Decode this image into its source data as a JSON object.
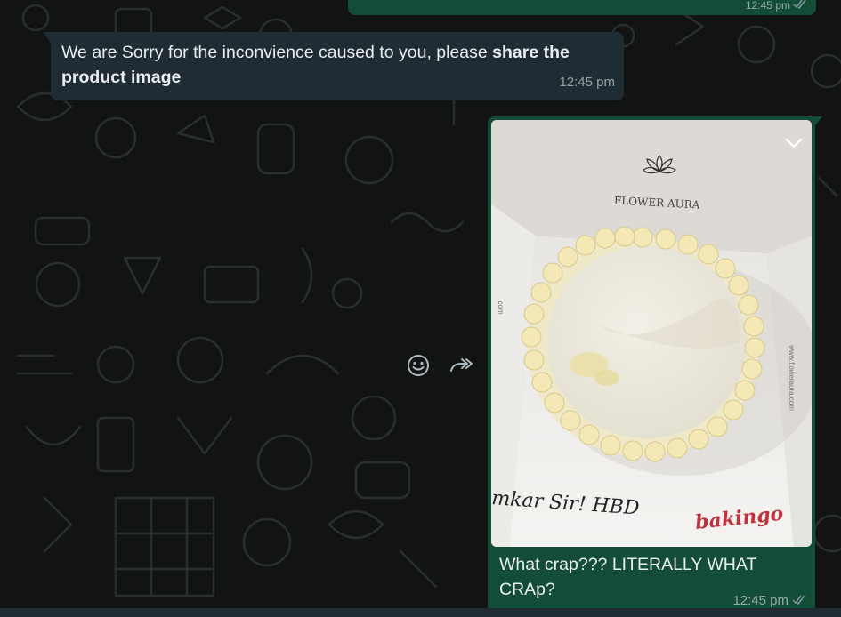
{
  "colors": {
    "background": "#121413",
    "incoming_bubble": "#202c33",
    "outgoing_bubble": "#144d37",
    "text": "#e9edef",
    "meta_text": "#8696a0"
  },
  "messages": [
    {
      "direction": "outgoing",
      "time": "12:45 pm",
      "status_icon": "double-check-icon"
    },
    {
      "direction": "incoming",
      "text_regular": "We are Sorry for the inconvience caused to you, please ",
      "text_bold": "share the product image",
      "time": "12:45 pm"
    },
    {
      "direction": "outgoing",
      "type": "image",
      "photo": {
        "box_brand": "FLOWER AURA",
        "box_url": "www.floweraura.com",
        "cake_writing": "mkar Sir! HBD",
        "bakery_brand": "bakingo"
      },
      "caption": "What crap??? LITERALLY WHAT CRAp?",
      "time": "12:45 pm",
      "status_icon": "double-check-icon"
    }
  ],
  "hover_actions": {
    "react_icon": "smiley-icon",
    "forward_icon": "forward-icon"
  }
}
